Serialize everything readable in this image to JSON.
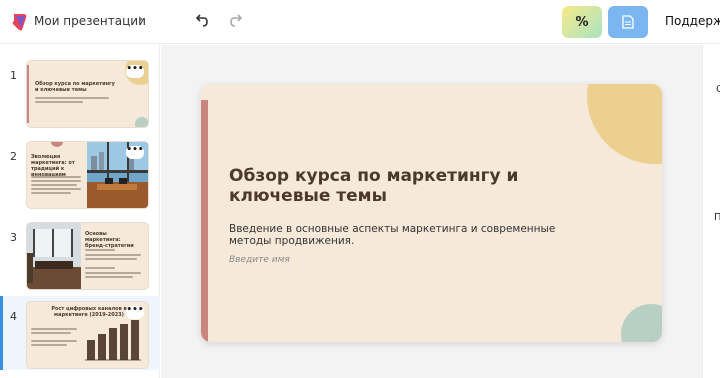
{
  "header": {
    "breadcrumb": "Мои презентации",
    "percent_label": "%",
    "support_label": "Поддерж"
  },
  "slides": [
    {
      "number": "1",
      "title": "Обзор курса по маркетингу и ключевые темы"
    },
    {
      "number": "2",
      "title": "Эволюция маркетинга: от традиций к инновациям"
    },
    {
      "number": "3",
      "title": "Основы маркетинга: бренд-стратегии"
    },
    {
      "number": "4",
      "title": "Рост цифровых каналов в маркетинге (2019-2023)"
    }
  ],
  "slide_menu_label": "•••",
  "canvas": {
    "title": "Обзор курса по маркетингу и ключевые темы",
    "subtitle": "Введение в основные аспекты маркетинга и современные методы продвижения.",
    "name_placeholder": "Введите имя"
  },
  "right_panel": {
    "label1": "С",
    "label2": "П"
  },
  "colors": {
    "slide_bg": "#f6e9d9",
    "accent_bar": "#c9867e",
    "circle_yellow": "#ecd08f",
    "circle_green": "#b7d0c3",
    "active_blue": "#3b8fe0"
  }
}
